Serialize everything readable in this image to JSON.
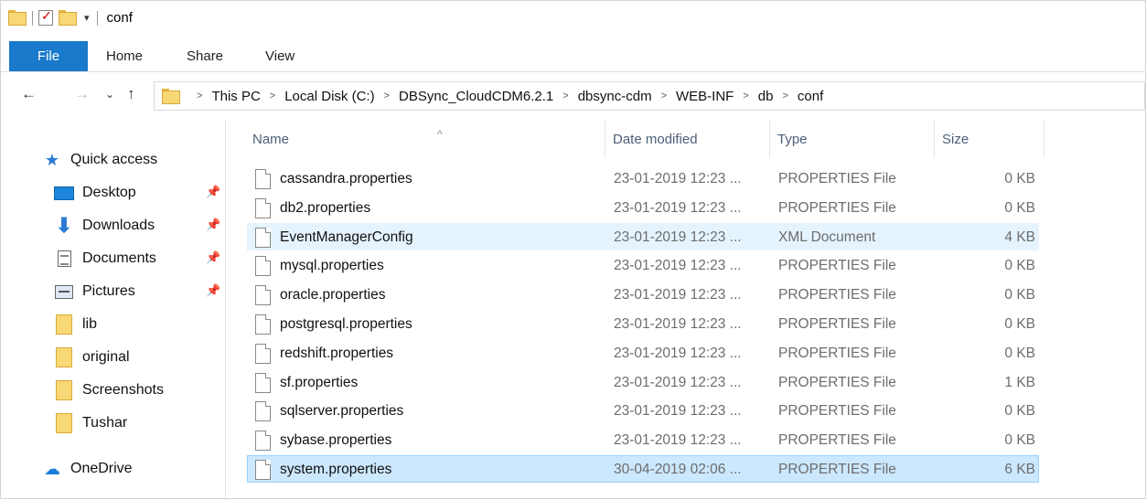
{
  "titlebar": {
    "title": "conf"
  },
  "ribbon": {
    "tabs": [
      "File",
      "Home",
      "Share",
      "View"
    ]
  },
  "address": {
    "crumbs": [
      "This PC",
      "Local Disk (C:)",
      "DBSync_CloudCDM6.2.1",
      "dbsync-cdm",
      "WEB-INF",
      "db",
      "conf"
    ]
  },
  "sidebar": {
    "quick_access": "Quick access",
    "items": [
      {
        "label": "Desktop",
        "icon": "desktop-icon",
        "pinned": true
      },
      {
        "label": "Downloads",
        "icon": "downloads-icon",
        "pinned": true
      },
      {
        "label": "Documents",
        "icon": "documents-icon",
        "pinned": true
      },
      {
        "label": "Pictures",
        "icon": "pictures-icon",
        "pinned": true
      },
      {
        "label": "lib",
        "icon": "folder-icon",
        "pinned": false
      },
      {
        "label": "original",
        "icon": "folder-icon",
        "pinned": false
      },
      {
        "label": "Screenshots",
        "icon": "folder-icon",
        "pinned": false
      },
      {
        "label": "Tushar",
        "icon": "folder-icon",
        "pinned": false
      }
    ],
    "onedrive": "OneDrive"
  },
  "columns": {
    "name": "Name",
    "date": "Date modified",
    "type": "Type",
    "size": "Size"
  },
  "files": [
    {
      "name": "cassandra.properties",
      "date": "23-01-2019 12:23 ...",
      "type": "PROPERTIES File",
      "size": "0 KB",
      "state": ""
    },
    {
      "name": "db2.properties",
      "date": "23-01-2019 12:23 ...",
      "type": "PROPERTIES File",
      "size": "0 KB",
      "state": ""
    },
    {
      "name": "EventManagerConfig",
      "date": "23-01-2019 12:23 ...",
      "type": "XML Document",
      "size": "4 KB",
      "state": "hover"
    },
    {
      "name": "mysql.properties",
      "date": "23-01-2019 12:23 ...",
      "type": "PROPERTIES File",
      "size": "0 KB",
      "state": ""
    },
    {
      "name": "oracle.properties",
      "date": "23-01-2019 12:23 ...",
      "type": "PROPERTIES File",
      "size": "0 KB",
      "state": ""
    },
    {
      "name": "postgresql.properties",
      "date": "23-01-2019 12:23 ...",
      "type": "PROPERTIES File",
      "size": "0 KB",
      "state": ""
    },
    {
      "name": "redshift.properties",
      "date": "23-01-2019 12:23 ...",
      "type": "PROPERTIES File",
      "size": "0 KB",
      "state": ""
    },
    {
      "name": "sf.properties",
      "date": "23-01-2019 12:23 ...",
      "type": "PROPERTIES File",
      "size": "1 KB",
      "state": ""
    },
    {
      "name": "sqlserver.properties",
      "date": "23-01-2019 12:23 ...",
      "type": "PROPERTIES File",
      "size": "0 KB",
      "state": ""
    },
    {
      "name": "sybase.properties",
      "date": "23-01-2019 12:23 ...",
      "type": "PROPERTIES File",
      "size": "0 KB",
      "state": ""
    },
    {
      "name": "system.properties",
      "date": "30-04-2019 02:06 ...",
      "type": "PROPERTIES File",
      "size": "6 KB",
      "state": "selected"
    }
  ],
  "colors": {
    "file_tab": "#1979ca",
    "hover_row": "#e5f3ff",
    "selected_row": "#cce8ff",
    "header_text": "#4c607a"
  }
}
